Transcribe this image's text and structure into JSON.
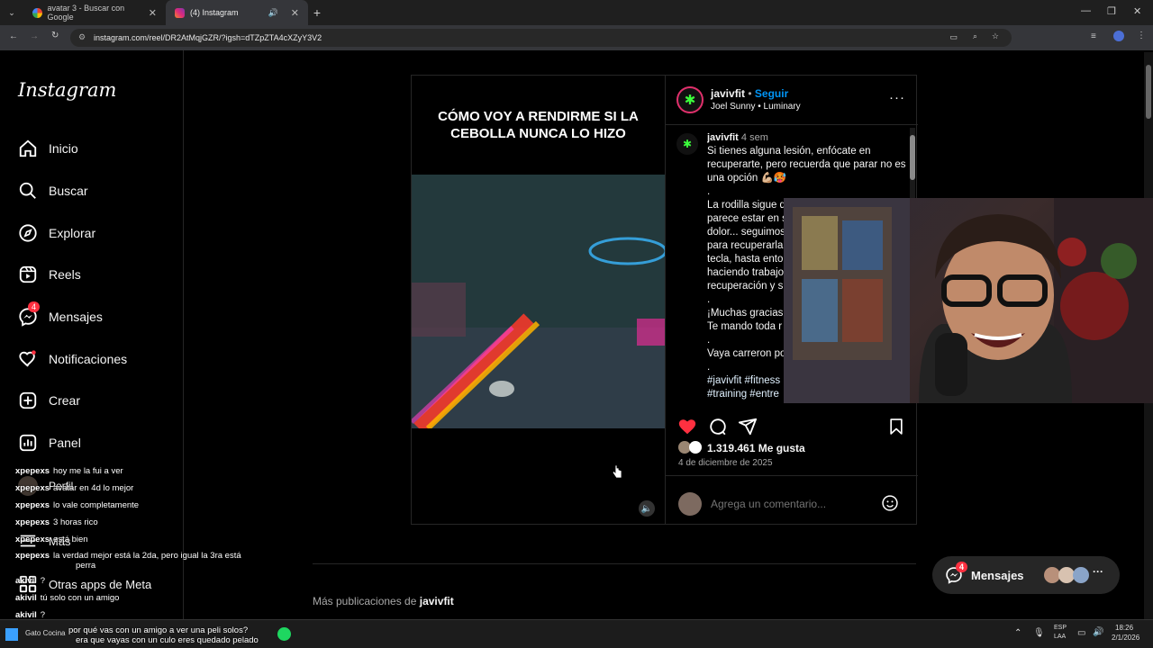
{
  "browser": {
    "tabs": [
      {
        "title": "avatar 3 - Buscar con Google"
      },
      {
        "title": "(4) Instagram"
      }
    ],
    "url": "instagram.com/reel/DR2AtMqjGZR/?igsh=dTZpZTA4cXZyY3V2"
  },
  "sidebar": {
    "logo": "Instagram",
    "items": [
      {
        "label": "Inicio",
        "icon": "home-icon"
      },
      {
        "label": "Buscar",
        "icon": "search-icon"
      },
      {
        "label": "Explorar",
        "icon": "compass-icon"
      },
      {
        "label": "Reels",
        "icon": "reels-icon"
      },
      {
        "label": "Mensajes",
        "icon": "messenger-icon",
        "badge": "4"
      },
      {
        "label": "Notificaciones",
        "icon": "heart-icon"
      },
      {
        "label": "Crear",
        "icon": "plus-square-icon"
      },
      {
        "label": "Panel",
        "icon": "dashboard-icon"
      },
      {
        "label": "Perfil",
        "icon": "avatar"
      },
      {
        "label": "Más",
        "icon": "menu-icon"
      },
      {
        "label": "Otras apps de Meta",
        "icon": "meta-apps-icon"
      }
    ]
  },
  "post": {
    "video_caption": "CÓMO VOY A RENDIRME SI LA CEBOLLA NUNCA LO HIZO",
    "author": "javivfit",
    "follow": "Seguir",
    "audio_artist": "Joel Sunny",
    "audio_track": "Luminary",
    "caption_age": "4 sem",
    "caption_lines": [
      "Si tienes alguna lesión, enfócate en recuperarte, pero recuerda que parar no es una opción 💪🏼🥵",
      ".",
      "La rodilla sigue d",
      "parece estar en s",
      "dolor... seguimos",
      "para recuperarla",
      "tecla, hasta ento",
      "haciendo trabajo",
      "recuperación y s",
      ".",
      "¡Muchas gracias",
      "Te mando toda r",
      ".",
      "Vaya carreron po",
      "."
    ],
    "hashtags_1": "#javivfit #fitness",
    "hashtags_2": "#training #entre",
    "likes": "1.319.461 Me gusta",
    "date": "4 de diciembre de 2025",
    "comment_placeholder": "Agrega un comentario..."
  },
  "more_posts_prefix": "Más publicaciones de",
  "more_posts_user": "javivfit",
  "messages_pill": {
    "label": "Mensajes",
    "badge": "4"
  },
  "chat": [
    {
      "user": "xpepexs",
      "msg": "hoy me la fui a ver"
    },
    {
      "user": "xpepexs",
      "msg": "avatar en 4d lo mejor"
    },
    {
      "user": "xpepexs",
      "msg": "lo vale completamente"
    },
    {
      "user": "xpepexs",
      "msg": "3 horas rico"
    },
    {
      "user": "xpepexs",
      "msg": "está bien"
    },
    {
      "user": "xpepexs",
      "msg": "la verdad mejor está la 2da, pero igual la 3ra está"
    },
    {
      "user": "",
      "msg": "perra"
    },
    {
      "user": "akivil",
      "msg": "?"
    },
    {
      "user": "akivil",
      "msg": "tú solo con un amigo"
    },
    {
      "user": "akivil",
      "msg": "?"
    },
    {
      "user": "",
      "msg": "por qué vas con un amigo a ver una peli solos?"
    },
    {
      "user": "",
      "msg": "era que vayas con un culo eres quedado pelado"
    }
  ],
  "taskbar": {
    "lang": "ESP",
    "lang2": "LAA",
    "time": "18:26",
    "date": "2/1/2026",
    "gato": "Gato Cocina"
  },
  "colors": {
    "accent": "#0095f6",
    "like": "#ff3040",
    "bg": "#000000"
  }
}
